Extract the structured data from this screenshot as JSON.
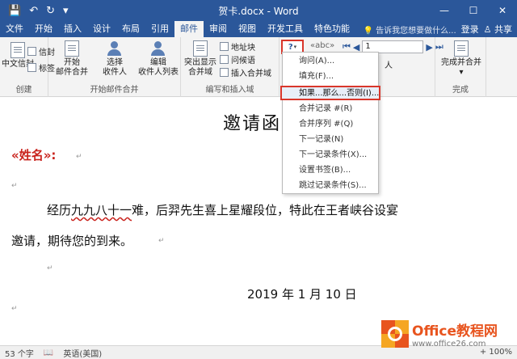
{
  "titlebar": {
    "doc_title": "贺卡.docx - Word",
    "qa_save": "💾",
    "qa_undo": "↶",
    "qa_redo": "↻",
    "qa_more": "▾",
    "win_min": "—",
    "win_max": "☐",
    "win_close": "✕"
  },
  "tabs": [
    {
      "label": "文件"
    },
    {
      "label": "开始"
    },
    {
      "label": "插入"
    },
    {
      "label": "设计"
    },
    {
      "label": "布局"
    },
    {
      "label": "引用"
    },
    {
      "label": "邮件",
      "active": true
    },
    {
      "label": "审阅"
    },
    {
      "label": "视图"
    },
    {
      "label": "开发工具"
    },
    {
      "label": "特色功能"
    }
  ],
  "tab_extra": {
    "tell_me": "💡 告诉我您想要做什么...",
    "login": "登录",
    "share": "♙ 共享"
  },
  "ribbon": {
    "group_create": {
      "label": "创建",
      "chinese_envelope": "中文信封",
      "envelope": "信封",
      "labels": "标签"
    },
    "group_start_merge": {
      "label": "开始邮件合并",
      "start_merge": "开始",
      "start_merge_2": "邮件合并",
      "select_recipients": "选择",
      "select_recipients_2": "收件人",
      "edit_list": "编辑",
      "edit_list_2": "收件人列表"
    },
    "group_write_insert": {
      "label": "编写和插入域",
      "highlight_fields": "突出显示",
      "highlight_fields_2": "合并域",
      "address_block": "地址块",
      "greeting_line": "问候语",
      "insert_merge_field": "插入合并域"
    },
    "rules_button": "?",
    "abc_label": "«abc»",
    "record_value": "1",
    "recipient_suffix": "人",
    "group_finish": {
      "label": "完成",
      "finish_merge": "完成并合并"
    }
  },
  "rules_menu": {
    "items": [
      "询问(A)...",
      "填充(F)...",
      "如果...那么...否则(I)...",
      "合并记录 #(R)",
      "合并序列 #(Q)",
      "下一记录(N)",
      "下一记录条件(X)...",
      "设置书签(B)...",
      "跳过记录条件(S)..."
    ],
    "highlighted_index": 2
  },
  "document": {
    "heading": "邀请函",
    "merge_field": "«姓名»:",
    "line1_pre": "经历",
    "line1_under": "九九八十一",
    "line1_post": "难，后羿先生喜上星耀段位，特此在王者峡谷设宴",
    "line2": "邀请，期待您的到来。",
    "date": "2019 年 1 月 10 日",
    "para_mark": "↵"
  },
  "statusbar": {
    "word_count": "53 个字",
    "proof_icon": "📖",
    "language": "英语(美国)",
    "zoom": "+ 100%"
  },
  "watermark": {
    "name": "Office教程网",
    "url": "www.office26.com"
  },
  "colors": {
    "title_blue": "#2b579a",
    "highlight_red": "#d9362b",
    "field_red": "#c9231d"
  }
}
